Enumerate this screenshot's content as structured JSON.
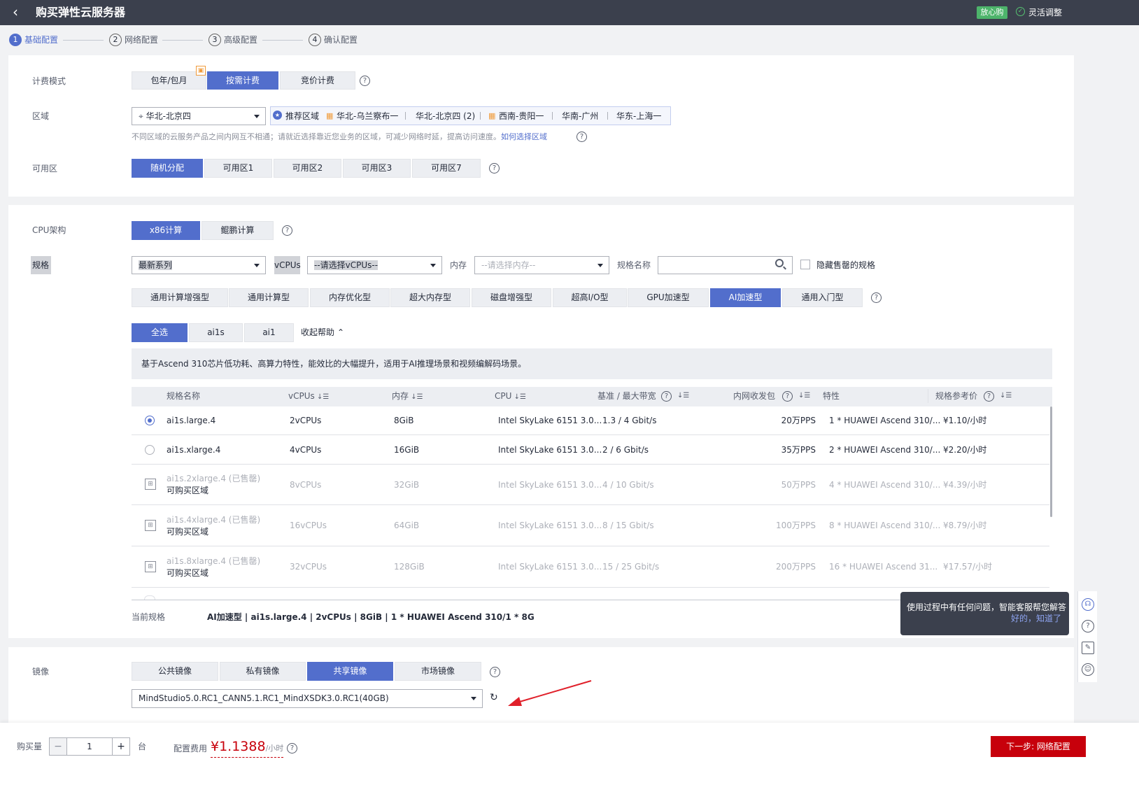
{
  "header": {
    "title": "购买弹性云服务器",
    "badge": "放心购",
    "flex_adjust": "灵活调整"
  },
  "steps": [
    {
      "num": "1",
      "label": "基础配置"
    },
    {
      "num": "2",
      "label": "网络配置"
    },
    {
      "num": "3",
      "label": "高级配置"
    },
    {
      "num": "4",
      "label": "确认配置"
    }
  ],
  "billing": {
    "label": "计费模式",
    "options": [
      "包年/包月",
      "按需计费",
      "竞价计费"
    ],
    "selected": "按需计费"
  },
  "region": {
    "label": "区域",
    "value": "华北-北京四",
    "recommended_label": "推荐区域",
    "recommended": [
      "华北-乌兰察布一",
      "华北-北京四 (2)",
      "西南-贵阳一",
      "华南-广州",
      "华东-上海一"
    ],
    "note": "不同区域的云服务产品之间内网互不相通；请就近选择靠近您业务的区域，可减少网络时延，提高访问速度。",
    "note_link": "如何选择区域"
  },
  "az": {
    "label": "可用区",
    "options": [
      "随机分配",
      "可用区1",
      "可用区2",
      "可用区3",
      "可用区7"
    ],
    "selected": "随机分配"
  },
  "cpu_arch": {
    "label": "CPU架构",
    "options": [
      "x86计算",
      "鲲鹏计算"
    ],
    "selected": "x86计算"
  },
  "spec_filter": {
    "label": "规格",
    "series": "最新系列",
    "vcpus_label": "vCPUs",
    "vcpus_placeholder": "--请选择vCPUs--",
    "mem_label": "内存",
    "mem_placeholder": "--请选择内存--",
    "name_label": "规格名称",
    "name_value": "",
    "hide_soldout": "隐藏售罄的规格"
  },
  "spec_types": [
    "通用计算增强型",
    "通用计算型",
    "内存优化型",
    "超大内存型",
    "磁盘增强型",
    "超高I/O型",
    "GPU加速型",
    "AI加速型",
    "通用入门型"
  ],
  "spec_type_selected": "AI加速型",
  "sub_filters": [
    "全选",
    "ai1s",
    "ai1"
  ],
  "collapse_help": "收起帮助",
  "help_text": "基于Ascend 310芯片低功耗、高算力特性，能效比的大幅提升，适用于AI推理场景和视频编解码场景。",
  "table": {
    "headers": [
      "规格名称",
      "vCPUs",
      "内存",
      "CPU",
      "基准 / 最大带宽",
      "内网收发包",
      "特性",
      "规格参考价"
    ],
    "rows": [
      {
        "name": "ai1s.large.4",
        "sub": "",
        "vcpus": "2vCPUs",
        "mem": "8GiB",
        "cpu": "Intel SkyLake 6151 3.0...",
        "bw": "1.3 / 4 Gbit/s",
        "pps": "20万PPS",
        "feature": "1 * HUAWEI Ascend 310/...",
        "price": "¥1.10/小时"
      },
      {
        "name": "ai1s.xlarge.4",
        "sub": "",
        "vcpus": "4vCPUs",
        "mem": "16GiB",
        "cpu": "Intel SkyLake 6151 3.0...",
        "bw": "2 / 6 Gbit/s",
        "pps": "35万PPS",
        "feature": "2 * HUAWEI Ascend 310/...",
        "price": "¥2.20/小时"
      },
      {
        "name": "ai1s.2xlarge.4 (已售罄)",
        "sub": "可购买区域",
        "vcpus": "8vCPUs",
        "mem": "32GiB",
        "cpu": "Intel SkyLake 6151 3.0...",
        "bw": "4 / 10 Gbit/s",
        "pps": "50万PPS",
        "feature": "4 * HUAWEI Ascend 310/...",
        "price": "¥4.39/小时"
      },
      {
        "name": "ai1s.4xlarge.4 (已售罄)",
        "sub": "可购买区域",
        "vcpus": "16vCPUs",
        "mem": "64GiB",
        "cpu": "Intel SkyLake 6151 3.0...",
        "bw": "8 / 15 Gbit/s",
        "pps": "100万PPS",
        "feature": "8 * HUAWEI Ascend 310/...",
        "price": "¥8.79/小时"
      },
      {
        "name": "ai1s.8xlarge.4 (已售罄)",
        "sub": "可购买区域",
        "vcpus": "32vCPUs",
        "mem": "128GiB",
        "cpu": "Intel SkyLake 6151 3.0...",
        "bw": "15 / 25 Gbit/s",
        "pps": "200万PPS",
        "feature": "16 * HUAWEI Ascend 31...",
        "price": "¥17.57/小时"
      }
    ]
  },
  "current_spec": {
    "label": "当前规格",
    "value": "AI加速型 | ai1s.large.4 | 2vCPUs | 8GiB | 1 * HUAWEI Ascend 310/1 * 8G"
  },
  "image": {
    "label": "镜像",
    "options": [
      "公共镜像",
      "私有镜像",
      "共享镜像",
      "市场镜像"
    ],
    "selected": "共享镜像",
    "value": "MindStudio5.0.RC1_CANN5.1.RC1_MindXSDK3.0.RC1(40GB)"
  },
  "footer": {
    "qty_label": "购买量",
    "qty": "1",
    "unit": "台",
    "fee_label": "配置费用",
    "fee": "¥1.1388",
    "fee_unit": "/小时",
    "next_button": "下一步: 网络配置"
  },
  "tooltip": {
    "text": "使用过程中有任何问题，智能客服帮您解答",
    "link": "好的，知道了"
  },
  "colors": {
    "accent": "#526ecc",
    "header_bg": "#3b404d",
    "price_red": "#c7000b",
    "arrow_red": "#e0202a",
    "badge_green": "#4db46b"
  }
}
